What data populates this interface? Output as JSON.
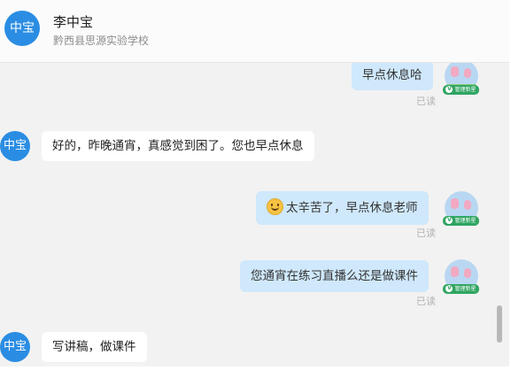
{
  "header": {
    "avatar_text": "中宝",
    "contact_name": "李中宝",
    "contact_school": "黔西县思源实验学校"
  },
  "messages": [
    {
      "direction": "out",
      "text": "早点休息哈",
      "status": "已读",
      "badge": "管理新星"
    },
    {
      "direction": "in",
      "text": "好的，昨晚通宵，真感觉到困了。您也早点休息",
      "avatar_text": "中宝"
    },
    {
      "direction": "out",
      "text": "太辛苦了，早点休息老师",
      "emoji": "smile-emoji",
      "status": "已读",
      "badge": "管理新星"
    },
    {
      "direction": "out",
      "text": "您通宵在练习直播么还是做课件",
      "status": "已读",
      "badge": "管理新星"
    },
    {
      "direction": "in",
      "text": "写讲稿，做课件",
      "avatar_text": "中宝"
    }
  ],
  "colors": {
    "avatar_blue": "#2a8de3",
    "bubble_out": "#cfe8fb",
    "bubble_in": "#ffffff",
    "chat_bg": "#f2f2f2",
    "badge_green": "#2fa561"
  }
}
